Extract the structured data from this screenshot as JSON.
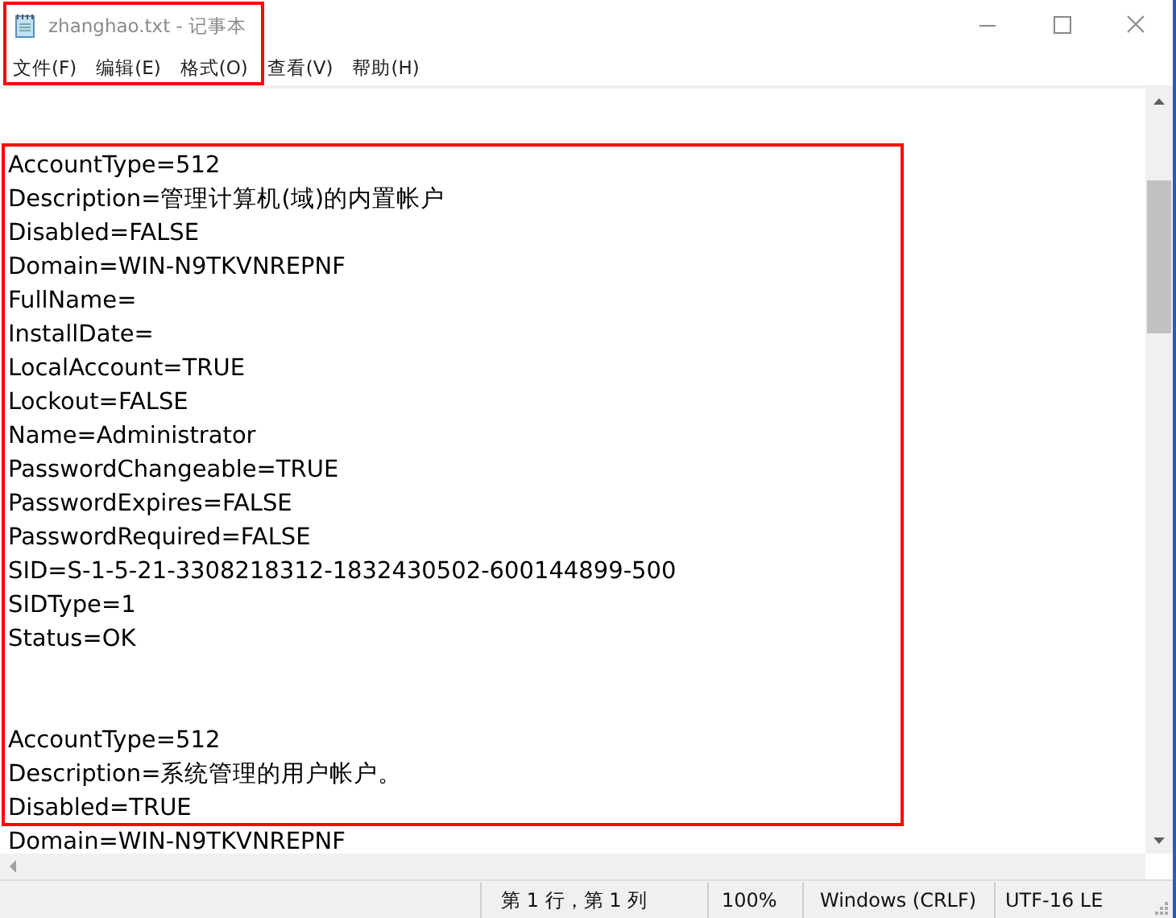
{
  "window": {
    "title": "zhanghao.txt - 记事本"
  },
  "menu": [
    "文件(F)",
    "编辑(E)",
    "格式(O)",
    "查看(V)",
    "帮助(H)"
  ],
  "records": [
    {
      "lines": [
        "AccountType=512",
        "Description=管理计算机(域)的内置帐户",
        "Disabled=FALSE",
        "Domain=WIN-N9TKVNREPNF",
        "FullName=",
        "InstallDate=",
        "LocalAccount=TRUE",
        "Lockout=FALSE",
        "Name=Administrator",
        "PasswordChangeable=TRUE",
        "PasswordExpires=FALSE",
        "PasswordRequired=FALSE",
        "SID=S-1-5-21-3308218312-1832430502-600144899-500",
        "SIDType=1",
        "Status=OK"
      ]
    },
    {
      "lines": [
        "AccountType=512",
        "Description=系统管理的用户帐户。",
        "Disabled=TRUE",
        "Domain=WIN-N9TKVNREPNF"
      ]
    }
  ],
  "status_bar": [
    "第 1 行，第 1 列",
    "100%",
    "Windows (CRLF)",
    "UTF-16 LE"
  ]
}
